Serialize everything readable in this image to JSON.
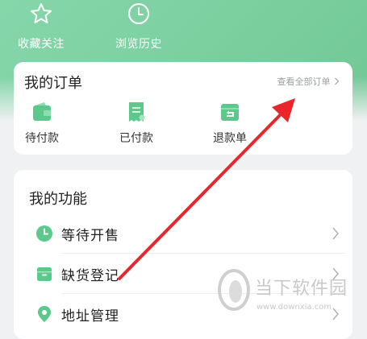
{
  "quick_links": [
    {
      "label": "收藏关注",
      "icon": "star-icon"
    },
    {
      "label": "浏览历史",
      "icon": "clock-icon"
    }
  ],
  "orders": {
    "title": "我的订单",
    "view_all": "查看全部订单",
    "items": [
      {
        "label": "待付款",
        "icon": "wallet-icon"
      },
      {
        "label": "已付款",
        "icon": "receipt-icon"
      },
      {
        "label": "退款单",
        "icon": "refund-icon"
      }
    ]
  },
  "functions": {
    "title": "我的功能",
    "items": [
      {
        "label": "等待开售",
        "icon": "clock-icon"
      },
      {
        "label": "缺货登记",
        "icon": "box-icon"
      },
      {
        "label": "地址管理",
        "icon": "location-icon"
      }
    ]
  },
  "watermark": {
    "brand": "当下软件园",
    "url": "www.downxia.com"
  },
  "colors": {
    "accent": "#5cc88b",
    "header": "#7bcf9f",
    "annotation_arrow": "#e8262b"
  }
}
